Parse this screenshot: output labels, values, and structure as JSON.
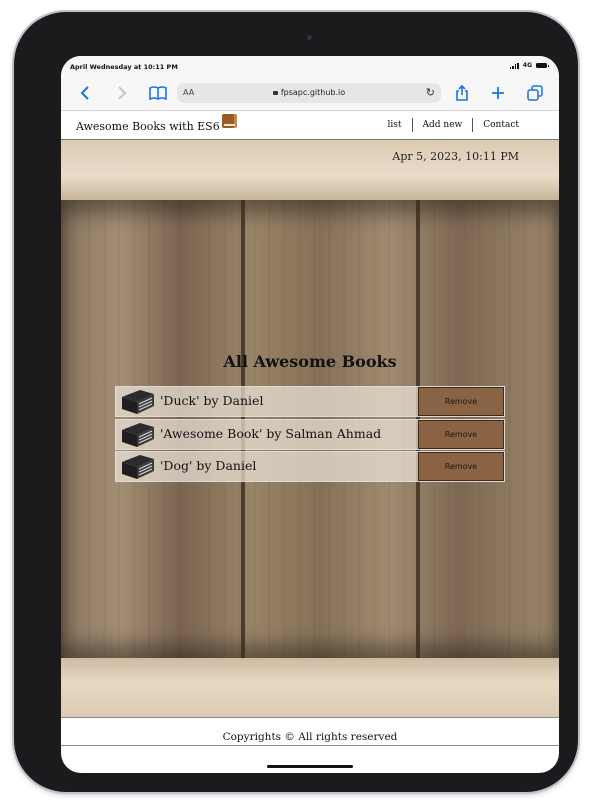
{
  "status_bar": {
    "time": "April Wednesday at 10:11 PM",
    "network": "4G"
  },
  "browser": {
    "text_size_label": "AA",
    "url": "fpsapc.github.io"
  },
  "nav": {
    "brand": "Awesome Books with ES6",
    "links": [
      "list",
      "Add new",
      "Contact"
    ]
  },
  "date_display": "Apr 5, 2023, 10:11 PM",
  "main": {
    "title": "All Awesome Books",
    "books": [
      {
        "text": "'Duck' by Daniel",
        "remove_label": "Remove"
      },
      {
        "text": "'Awesome Book' by Salman Ahmad",
        "remove_label": "Remove"
      },
      {
        "text": "'Dog' by Daniel",
        "remove_label": "Remove"
      }
    ]
  },
  "footer": {
    "text": "Copyrights © All rights reserved"
  },
  "colors": {
    "accent": "#1a73e8",
    "remove_button": "#8a6244",
    "wood": "#8a7560"
  },
  "icons": [
    "back-icon",
    "forward-icon",
    "bookmarks-icon",
    "lock-icon",
    "reload-icon",
    "share-icon",
    "new-tab-icon",
    "tabs-icon",
    "book-emoji-icon",
    "book-icon"
  ]
}
